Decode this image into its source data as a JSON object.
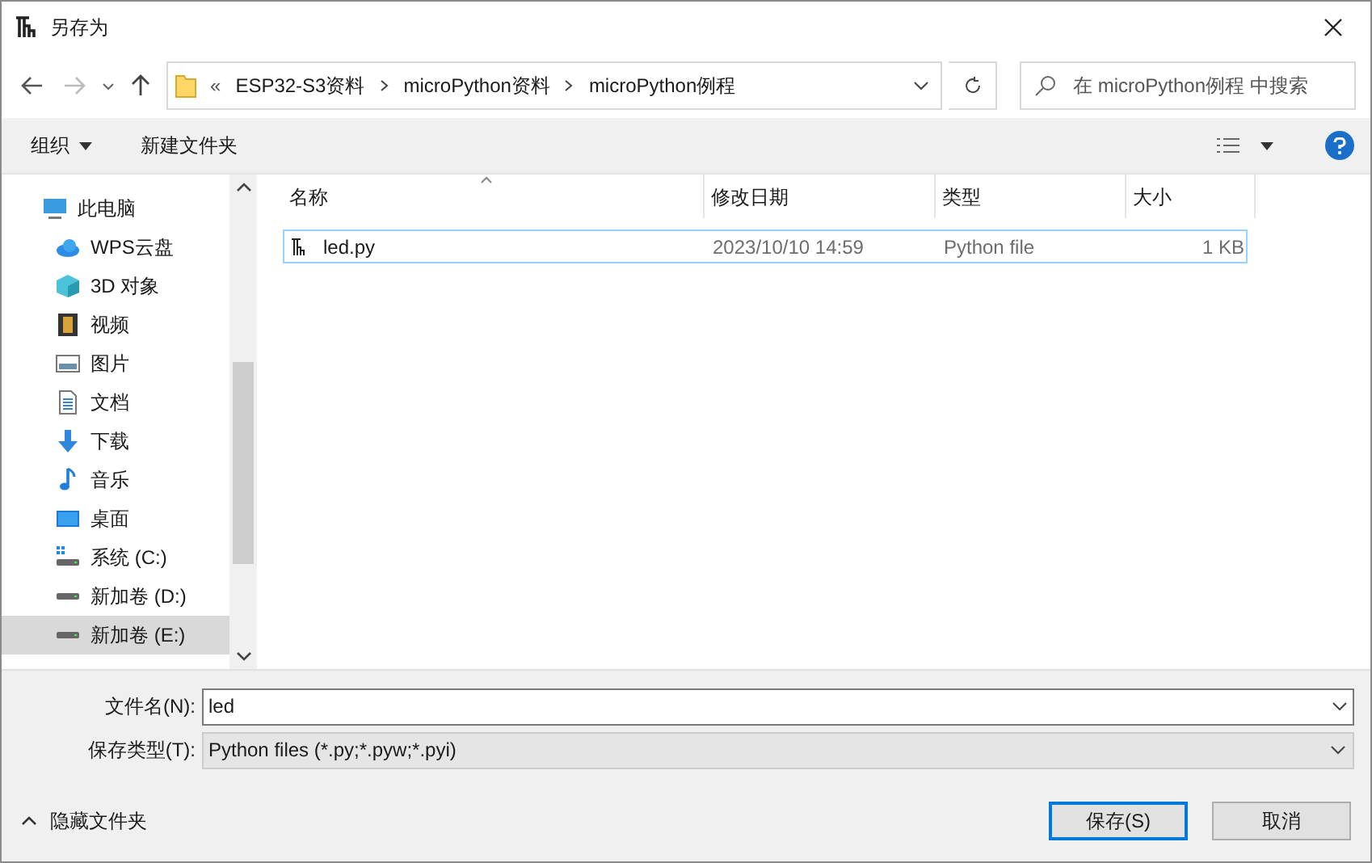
{
  "window": {
    "title": "另存为"
  },
  "address_bar": {
    "prefix": "«",
    "crumbs": [
      "ESP32-S3资料",
      "microPython资料",
      "microPython例程"
    ]
  },
  "search": {
    "placeholder": "在 microPython例程 中搜索"
  },
  "toolbar": {
    "organize": "组织",
    "new_folder": "新建文件夹"
  },
  "sidebar": {
    "items": [
      {
        "label": "此电脑",
        "kind": "pc",
        "selected": false
      },
      {
        "label": "WPS云盘",
        "kind": "cloud",
        "selected": false
      },
      {
        "label": "3D 对象",
        "kind": "cube",
        "selected": false
      },
      {
        "label": "视频",
        "kind": "video",
        "selected": false
      },
      {
        "label": "图片",
        "kind": "picture",
        "selected": false
      },
      {
        "label": "文档",
        "kind": "document",
        "selected": false
      },
      {
        "label": "下载",
        "kind": "download",
        "selected": false
      },
      {
        "label": "音乐",
        "kind": "music",
        "selected": false
      },
      {
        "label": "桌面",
        "kind": "desktop",
        "selected": false
      },
      {
        "label": "系统 (C:)",
        "kind": "system_drive",
        "selected": false
      },
      {
        "label": "新加卷 (D:)",
        "kind": "drive",
        "selected": false
      },
      {
        "label": "新加卷 (E:)",
        "kind": "drive",
        "selected": true
      }
    ]
  },
  "table": {
    "columns": [
      "名称",
      "修改日期",
      "类型",
      "大小"
    ],
    "rows": [
      {
        "name": "led.py",
        "modified": "2023/10/10 14:59",
        "type": "Python file",
        "size": "1 KB",
        "selected": true
      }
    ]
  },
  "form": {
    "filename_label": "文件名(N):",
    "filename": "led",
    "filetype_label": "保存类型(T):",
    "filetype": "Python files (*.py;*.pyw;*.pyi)"
  },
  "footer": {
    "hide_folders": "隐藏文件夹",
    "save": "保存(S)",
    "cancel": "取消"
  }
}
